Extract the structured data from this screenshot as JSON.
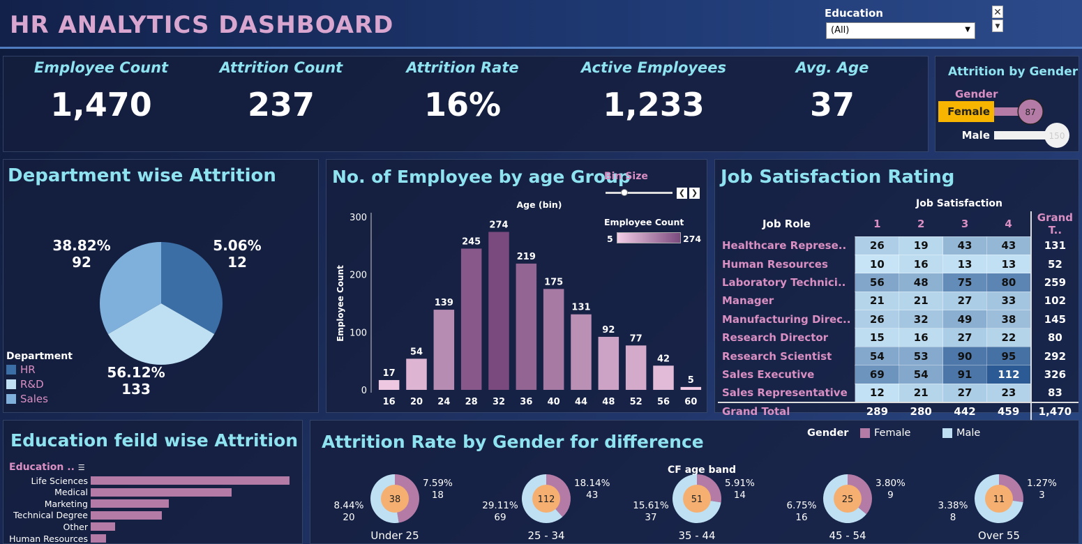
{
  "header": {
    "title": "HR ANALYTICS DASHBOARD",
    "filter_label": "Education",
    "filter_value": "(All)"
  },
  "kpis": [
    {
      "label": "Employee Count",
      "value": "1,470"
    },
    {
      "label": "Attrition Count",
      "value": "237"
    },
    {
      "label": "Attrition Rate",
      "value": "16%"
    },
    {
      "label": "Active Employees",
      "value": "1,233"
    },
    {
      "label": "Avg. Age",
      "value": "37"
    }
  ],
  "gender_panel": {
    "title": "Attrition by Gender",
    "legend_label": "Gender",
    "rows": [
      {
        "label": "Female",
        "value": "87",
        "fill": 0.58
      },
      {
        "label": "Male",
        "value": "150",
        "fill": 1.0
      }
    ]
  },
  "department": {
    "title": "Department wise Attrition",
    "legend_title": "Department",
    "legend": [
      {
        "label": "HR",
        "color": "#3a6ea5"
      },
      {
        "label": "R&D",
        "color": "#bfe0f3"
      },
      {
        "label": "Sales",
        "color": "#7fb0dc"
      }
    ],
    "slices": [
      {
        "name": "HR",
        "pct": "5.06%",
        "count": "12",
        "color": "#3a6ea5"
      },
      {
        "name": "R&D",
        "pct": "56.12%",
        "count": "133",
        "color": "#bfe0f3"
      },
      {
        "name": "Sales",
        "pct": "38.82%",
        "count": "92",
        "color": "#7fb0dc"
      }
    ]
  },
  "age_group": {
    "title": "No. of Employee by age Group",
    "bin_size_label": "Bin Size",
    "x_title": "Age (bin)",
    "y_title": "Employee Count",
    "legend_title": "Employee Count",
    "legend_min": "5",
    "legend_max": "274",
    "nav_prev": "❮",
    "nav_next": "❯"
  },
  "chart_data": {
    "type": "bar",
    "categories": [
      "16",
      "20",
      "24",
      "28",
      "32",
      "36",
      "40",
      "44",
      "48",
      "52",
      "56",
      "60"
    ],
    "values": [
      17,
      54,
      139,
      245,
      274,
      219,
      175,
      131,
      92,
      77,
      42,
      5
    ],
    "xlabel": "Age (bin)",
    "ylabel": "Employee Count",
    "y_ticks": [
      "0",
      "100",
      "200",
      "300"
    ],
    "ylim": [
      0,
      300
    ]
  },
  "job": {
    "title": "Job Satisfaction Rating",
    "col_group": "Job Satisfaction",
    "row_header": "Job Role",
    "cols": [
      "1",
      "2",
      "3",
      "4"
    ],
    "total_header": "Grand T..",
    "rows": [
      {
        "role": "Healthcare Represe..",
        "v": [
          26,
          19,
          43,
          43
        ],
        "t": "131"
      },
      {
        "role": "Human Resources",
        "v": [
          10,
          16,
          13,
          13
        ],
        "t": "52"
      },
      {
        "role": "Laboratory Technici..",
        "v": [
          56,
          48,
          75,
          80
        ],
        "t": "259"
      },
      {
        "role": "Manager",
        "v": [
          21,
          21,
          27,
          33
        ],
        "t": "102"
      },
      {
        "role": "Manufacturing Direc..",
        "v": [
          26,
          32,
          49,
          38
        ],
        "t": "145"
      },
      {
        "role": "Research Director",
        "v": [
          15,
          16,
          27,
          22
        ],
        "t": "80"
      },
      {
        "role": "Research Scientist",
        "v": [
          54,
          53,
          90,
          95
        ],
        "t": "292"
      },
      {
        "role": "Sales Executive",
        "v": [
          69,
          54,
          91,
          112
        ],
        "t": "326"
      },
      {
        "role": "Sales Representative",
        "v": [
          12,
          21,
          27,
          23
        ],
        "t": "83"
      }
    ],
    "total_label": "Grand Total",
    "totals": [
      "289",
      "280",
      "442",
      "459",
      "1,470"
    ]
  },
  "education": {
    "title": "Education feild wise Attrition",
    "axis_label": "Education ..",
    "rows": [
      {
        "label": "Life Sciences",
        "value": 89
      },
      {
        "label": "Medical",
        "value": 63
      },
      {
        "label": "Marketing",
        "value": 35
      },
      {
        "label": "Technical Degree",
        "value": 32
      },
      {
        "label": "Other",
        "value": 11
      },
      {
        "label": "Human Resources",
        "value": 7
      }
    ]
  },
  "gender_diff": {
    "title": "Attrition Rate by Gender for difference",
    "legend_title": "Gender",
    "legend": [
      {
        "label": "Female",
        "color": "#b57ba7"
      },
      {
        "label": "Male",
        "color": "#bfe0f3"
      }
    ],
    "band_label": "CF age band",
    "bands": [
      {
        "name": "Under 25",
        "total": "38",
        "f_pct": "7.59%",
        "f_cnt": "18",
        "m_pct": "8.44%",
        "m_cnt": "20"
      },
      {
        "name": "25 - 34",
        "total": "112",
        "f_pct": "18.14%",
        "f_cnt": "43",
        "m_pct": "29.11%",
        "m_cnt": "69"
      },
      {
        "name": "35 - 44",
        "total": "51",
        "f_pct": "5.91%",
        "f_cnt": "14",
        "m_pct": "15.61%",
        "m_cnt": "37"
      },
      {
        "name": "45 - 54",
        "total": "25",
        "f_pct": "3.80%",
        "f_cnt": "9",
        "m_pct": "6.75%",
        "m_cnt": "16"
      },
      {
        "name": "Over 55",
        "total": "11",
        "f_pct": "1.27%",
        "f_cnt": "3",
        "m_pct": "3.38%",
        "m_cnt": "8"
      }
    ]
  },
  "colors": {
    "accent_title": "#8fe3f0",
    "pink_label": "#d98fc2",
    "bar_pink": "#b57ba7",
    "highlight": "#f7b500"
  }
}
